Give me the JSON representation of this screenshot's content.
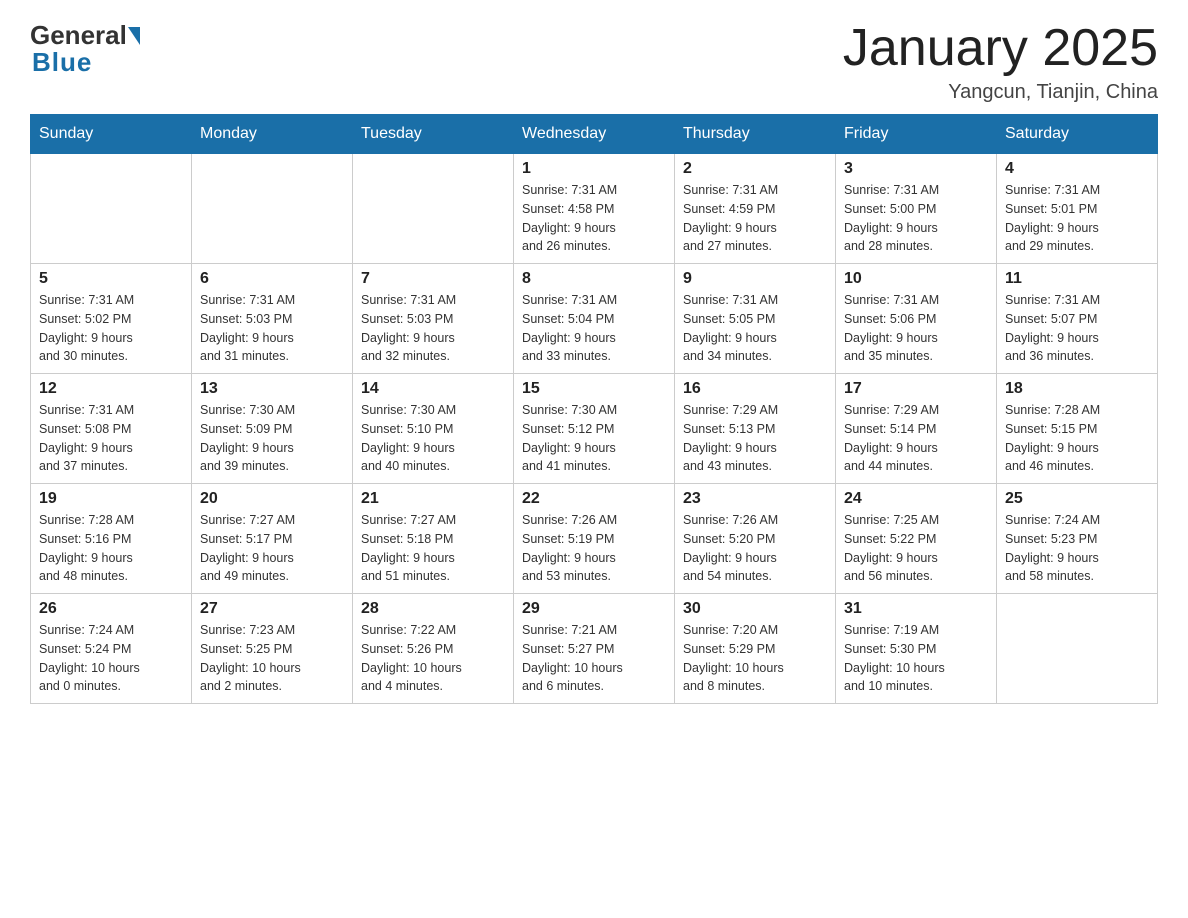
{
  "header": {
    "logo_general": "General",
    "logo_blue": "Blue",
    "title": "January 2025",
    "location": "Yangcun, Tianjin, China"
  },
  "days_of_week": [
    "Sunday",
    "Monday",
    "Tuesday",
    "Wednesday",
    "Thursday",
    "Friday",
    "Saturday"
  ],
  "weeks": [
    [
      {
        "day": "",
        "info": ""
      },
      {
        "day": "",
        "info": ""
      },
      {
        "day": "",
        "info": ""
      },
      {
        "day": "1",
        "info": "Sunrise: 7:31 AM\nSunset: 4:58 PM\nDaylight: 9 hours\nand 26 minutes."
      },
      {
        "day": "2",
        "info": "Sunrise: 7:31 AM\nSunset: 4:59 PM\nDaylight: 9 hours\nand 27 minutes."
      },
      {
        "day": "3",
        "info": "Sunrise: 7:31 AM\nSunset: 5:00 PM\nDaylight: 9 hours\nand 28 minutes."
      },
      {
        "day": "4",
        "info": "Sunrise: 7:31 AM\nSunset: 5:01 PM\nDaylight: 9 hours\nand 29 minutes."
      }
    ],
    [
      {
        "day": "5",
        "info": "Sunrise: 7:31 AM\nSunset: 5:02 PM\nDaylight: 9 hours\nand 30 minutes."
      },
      {
        "day": "6",
        "info": "Sunrise: 7:31 AM\nSunset: 5:03 PM\nDaylight: 9 hours\nand 31 minutes."
      },
      {
        "day": "7",
        "info": "Sunrise: 7:31 AM\nSunset: 5:03 PM\nDaylight: 9 hours\nand 32 minutes."
      },
      {
        "day": "8",
        "info": "Sunrise: 7:31 AM\nSunset: 5:04 PM\nDaylight: 9 hours\nand 33 minutes."
      },
      {
        "day": "9",
        "info": "Sunrise: 7:31 AM\nSunset: 5:05 PM\nDaylight: 9 hours\nand 34 minutes."
      },
      {
        "day": "10",
        "info": "Sunrise: 7:31 AM\nSunset: 5:06 PM\nDaylight: 9 hours\nand 35 minutes."
      },
      {
        "day": "11",
        "info": "Sunrise: 7:31 AM\nSunset: 5:07 PM\nDaylight: 9 hours\nand 36 minutes."
      }
    ],
    [
      {
        "day": "12",
        "info": "Sunrise: 7:31 AM\nSunset: 5:08 PM\nDaylight: 9 hours\nand 37 minutes."
      },
      {
        "day": "13",
        "info": "Sunrise: 7:30 AM\nSunset: 5:09 PM\nDaylight: 9 hours\nand 39 minutes."
      },
      {
        "day": "14",
        "info": "Sunrise: 7:30 AM\nSunset: 5:10 PM\nDaylight: 9 hours\nand 40 minutes."
      },
      {
        "day": "15",
        "info": "Sunrise: 7:30 AM\nSunset: 5:12 PM\nDaylight: 9 hours\nand 41 minutes."
      },
      {
        "day": "16",
        "info": "Sunrise: 7:29 AM\nSunset: 5:13 PM\nDaylight: 9 hours\nand 43 minutes."
      },
      {
        "day": "17",
        "info": "Sunrise: 7:29 AM\nSunset: 5:14 PM\nDaylight: 9 hours\nand 44 minutes."
      },
      {
        "day": "18",
        "info": "Sunrise: 7:28 AM\nSunset: 5:15 PM\nDaylight: 9 hours\nand 46 minutes."
      }
    ],
    [
      {
        "day": "19",
        "info": "Sunrise: 7:28 AM\nSunset: 5:16 PM\nDaylight: 9 hours\nand 48 minutes."
      },
      {
        "day": "20",
        "info": "Sunrise: 7:27 AM\nSunset: 5:17 PM\nDaylight: 9 hours\nand 49 minutes."
      },
      {
        "day": "21",
        "info": "Sunrise: 7:27 AM\nSunset: 5:18 PM\nDaylight: 9 hours\nand 51 minutes."
      },
      {
        "day": "22",
        "info": "Sunrise: 7:26 AM\nSunset: 5:19 PM\nDaylight: 9 hours\nand 53 minutes."
      },
      {
        "day": "23",
        "info": "Sunrise: 7:26 AM\nSunset: 5:20 PM\nDaylight: 9 hours\nand 54 minutes."
      },
      {
        "day": "24",
        "info": "Sunrise: 7:25 AM\nSunset: 5:22 PM\nDaylight: 9 hours\nand 56 minutes."
      },
      {
        "day": "25",
        "info": "Sunrise: 7:24 AM\nSunset: 5:23 PM\nDaylight: 9 hours\nand 58 minutes."
      }
    ],
    [
      {
        "day": "26",
        "info": "Sunrise: 7:24 AM\nSunset: 5:24 PM\nDaylight: 10 hours\nand 0 minutes."
      },
      {
        "day": "27",
        "info": "Sunrise: 7:23 AM\nSunset: 5:25 PM\nDaylight: 10 hours\nand 2 minutes."
      },
      {
        "day": "28",
        "info": "Sunrise: 7:22 AM\nSunset: 5:26 PM\nDaylight: 10 hours\nand 4 minutes."
      },
      {
        "day": "29",
        "info": "Sunrise: 7:21 AM\nSunset: 5:27 PM\nDaylight: 10 hours\nand 6 minutes."
      },
      {
        "day": "30",
        "info": "Sunrise: 7:20 AM\nSunset: 5:29 PM\nDaylight: 10 hours\nand 8 minutes."
      },
      {
        "day": "31",
        "info": "Sunrise: 7:19 AM\nSunset: 5:30 PM\nDaylight: 10 hours\nand 10 minutes."
      },
      {
        "day": "",
        "info": ""
      }
    ]
  ]
}
